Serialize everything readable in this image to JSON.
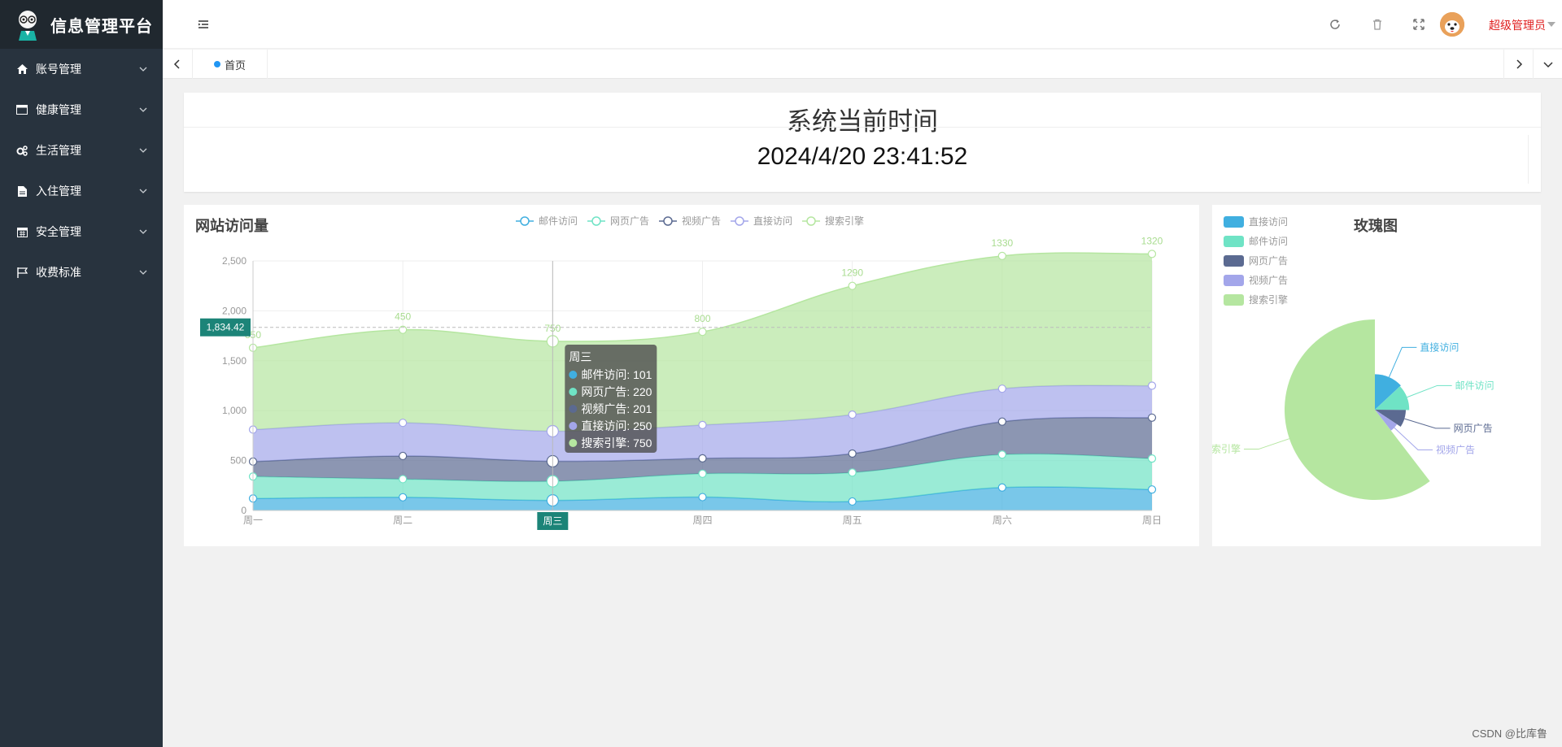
{
  "app": {
    "title": "信息管理平台"
  },
  "sidebar": {
    "items": [
      {
        "label": "账号管理",
        "icon": "home-icon"
      },
      {
        "label": "健康管理",
        "icon": "window-icon"
      },
      {
        "label": "生活管理",
        "icon": "gears-icon"
      },
      {
        "label": "入住管理",
        "icon": "document-icon"
      },
      {
        "label": "安全管理",
        "icon": "calendar-icon"
      },
      {
        "label": "收费标准",
        "icon": "flag-icon"
      }
    ]
  },
  "header": {
    "user_name": "超级管理员"
  },
  "tabs": {
    "home_label": "首页"
  },
  "time_card": {
    "title": "系统当前时间",
    "value": "2024/4/20 23:41:52"
  },
  "visits_chart": {
    "title": "网站访问量",
    "legend": [
      "邮件访问",
      "网页广告",
      "视频广告",
      "直接访问",
      "搜索引擎"
    ]
  },
  "rose_chart": {
    "title": "玫瑰图",
    "legend": [
      "直接访问",
      "邮件访问",
      "网页广告",
      "视频广告",
      "搜索引擎"
    ]
  },
  "footer": {
    "note": "CSDN @比库鲁"
  },
  "chart_data": [
    {
      "type": "area",
      "title": "网站访问量",
      "stacked": true,
      "smooth": true,
      "categories": [
        "周一",
        "周二",
        "周三",
        "周四",
        "周五",
        "周六",
        "周日"
      ],
      "ylim": [
        0,
        2500
      ],
      "yticks": [
        "0",
        "500",
        "1,000",
        "1,500",
        "2,000",
        "2,500"
      ],
      "series": [
        {
          "name": "邮件访问",
          "values": [
            120,
            132,
            101,
            134,
            90,
            230,
            210
          ],
          "color": "#40afe0"
        },
        {
          "name": "网页广告",
          "values": [
            220,
            182,
            191,
            234,
            290,
            330,
            310
          ],
          "color": "#6fe3c5"
        },
        {
          "name": "视频广告",
          "values": [
            150,
            232,
            201,
            154,
            190,
            330,
            410
          ],
          "color": "#5b6a91"
        },
        {
          "name": "直接访问",
          "values": [
            320,
            332,
            301,
            334,
            390,
            330,
            320
          ],
          "color": "#a3a6ea"
        },
        {
          "name": "搜索引擎",
          "values": [
            820,
            932,
            901,
            934,
            1290,
            1330,
            1320
          ],
          "color": "#b5e6a0"
        }
      ],
      "top_labels": [
        "850",
        "450",
        "750",
        "800",
        "1290",
        "1330",
        "1320"
      ],
      "axis_pointer": {
        "y_value": "1,834.42",
        "x_value": "周三"
      },
      "tooltip": {
        "title": "周三",
        "rows": [
          {
            "label": "邮件访问: 101",
            "color": "#40afe0"
          },
          {
            "label": "网页广告: 220",
            "color": "#6fe3c5"
          },
          {
            "label": "视频广告: 201",
            "color": "#5b6a91"
          },
          {
            "label": "直接访问: 250",
            "color": "#a3a6ea"
          },
          {
            "label": "搜索引擎: 750",
            "color": "#b5e6a0"
          }
        ]
      }
    },
    {
      "type": "pie",
      "title": "玫瑰图",
      "rose": true,
      "slices": [
        {
          "name": "直接访问",
          "value": 335,
          "color": "#40afe0"
        },
        {
          "name": "邮件访问",
          "value": 310,
          "color": "#6fe3c5"
        },
        {
          "name": "网页广告",
          "value": 234,
          "color": "#5b6a91"
        },
        {
          "name": "视频广告",
          "value": 135,
          "color": "#a3a6ea"
        },
        {
          "name": "搜索引擎",
          "value": 1548,
          "color": "#b5e6a0"
        }
      ],
      "legend_position": "top-left"
    }
  ]
}
